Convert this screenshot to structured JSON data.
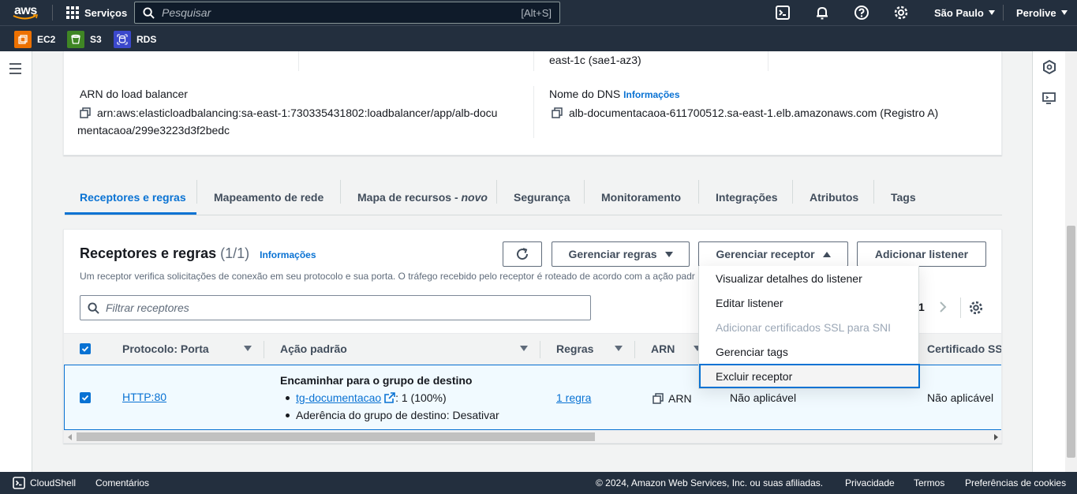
{
  "topnav": {
    "logo_text": "aws",
    "services_label": "Serviços",
    "search_placeholder": "Pesquisar",
    "search_shortcut": "[Alt+S]",
    "region": "São Paulo",
    "account": "Perolive"
  },
  "favorites": [
    {
      "label": "EC2",
      "color": "#ed7100"
    },
    {
      "label": "S3",
      "color": "#3f8624"
    },
    {
      "label": "RDS",
      "color": "#3b48cc"
    }
  ],
  "details": {
    "az_fragment": "east-1c (sae1-az3)",
    "arn_label": "ARN do load balancer",
    "arn_line1": "arn:aws:elasticloadbalancing:sa-east-1:730335431802:loadbalancer/app/alb-docu",
    "arn_line2": "mentacaoa/299e3223d3f2bedc",
    "dns_label": "Nome do DNS",
    "dns_info": "Informações",
    "dns_value": "alb-documentacaoa-611700512.sa-east-1.elb.amazonaws.com (Registro A)"
  },
  "tabs": [
    {
      "label": "Receptores e regras"
    },
    {
      "label": "Mapeamento de rede"
    },
    {
      "label": "Mapa de recursos - ",
      "suffix": "novo"
    },
    {
      "label": "Segurança"
    },
    {
      "label": "Monitoramento"
    },
    {
      "label": "Integrações"
    },
    {
      "label": "Atributos"
    },
    {
      "label": "Tags"
    }
  ],
  "listeners": {
    "title": "Receptores e regras",
    "count": "(1/1)",
    "info": "Informações",
    "description": "Um receptor verifica solicitações de conexão em seu protocolo e sua porta. O tráfego recebido pelo receptor é roteado de acordo com a ação padr",
    "btn_manage_rules": "Gerenciar regras",
    "btn_manage_listener": "Gerenciar receptor",
    "btn_add_listener": "Adicionar listener",
    "filter_placeholder": "Filtrar receptores",
    "page": "1",
    "columns": [
      "Protocolo: Porta",
      "Ação padrão",
      "Regras",
      "ARN",
      "Certificado SSL"
    ],
    "row": {
      "protocol": "HTTP:80",
      "action_title": "Encaminhar para o grupo de destino",
      "target_link": "tg-documentacao",
      "target_weight": ": 1 (100%)",
      "stickiness": "Aderência do grupo de destino: Desativar",
      "rules": "1 regra",
      "arn": "ARN",
      "col5": "Não aplicável",
      "ssl": "Não aplicável"
    }
  },
  "dropdown": {
    "items": [
      {
        "label": "Visualizar detalhes do listener",
        "disabled": false
      },
      {
        "label": "Editar listener",
        "disabled": false
      },
      {
        "label": "Adicionar certificados SSL para SNI",
        "disabled": true
      },
      {
        "label": "Gerenciar tags",
        "disabled": false
      },
      {
        "label": "Excluir receptor",
        "disabled": false,
        "focused": true
      }
    ]
  },
  "footer": {
    "cloudshell": "CloudShell",
    "feedback": "Comentários",
    "copyright": "© 2024, Amazon Web Services, Inc. ou suas afiliadas.",
    "privacy": "Privacidade",
    "terms": "Termos",
    "cookies": "Preferências de cookies"
  }
}
